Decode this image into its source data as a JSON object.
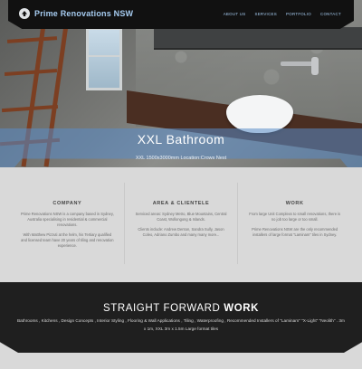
{
  "header": {
    "brand": "Prime Renovations NSW",
    "nav": [
      "ABOUT US",
      "SERVICES",
      "PORTFOLIO",
      "CONTACT"
    ]
  },
  "hero": {
    "title": "XXL Bathroom",
    "subtitle": "XXL 1500x3000mm Location:Crows Nest"
  },
  "columns": [
    {
      "heading": "COMPANY",
      "paragraphs": [
        "Prime Renovations NSW is a company based in Sydney, Australia specialising in residential & commercial renovations.",
        "With Matthew Pizzuti at the helm, his Tertiary qualified and licensed team have 20 years of tiling and renovation experience."
      ]
    },
    {
      "heading": "AREA & CLIENTELE",
      "paragraphs": [
        "Serviced areas: Sydney Metro, Blue Mountains, Central Coast, Wollongong & Islands.",
        "Clients include: Andrew Denton, Sandra Sully, Jason Coleo, Adriano Zumbo and many many more..."
      ]
    },
    {
      "heading": "WORK",
      "paragraphs": [
        "From large Unit Complexs to small renovations, there is no job too large or too small.",
        "Prime Renovations NSW are the only recommended installers of large format \"Laminam\" tiles in Sydney."
      ]
    }
  ],
  "footer": {
    "heading_light": "STRAIGHT FORWARD",
    "heading_bold": "WORK",
    "text": "Bathrooms , Kitchens , Design Concepts , Interior Styling , Flooring & Wall Applications , Tiling , Waterproofing , Recommended Installers of \"Laminam\" \"X-Light\" \"Neolith\" . 3m x 1m, XXL 3m x 1.5m Large format tiles"
  },
  "colors": {
    "accent": "#a7cdf2",
    "hero_band": "#5a8cc8",
    "dark_section": "#1f1f1f"
  }
}
